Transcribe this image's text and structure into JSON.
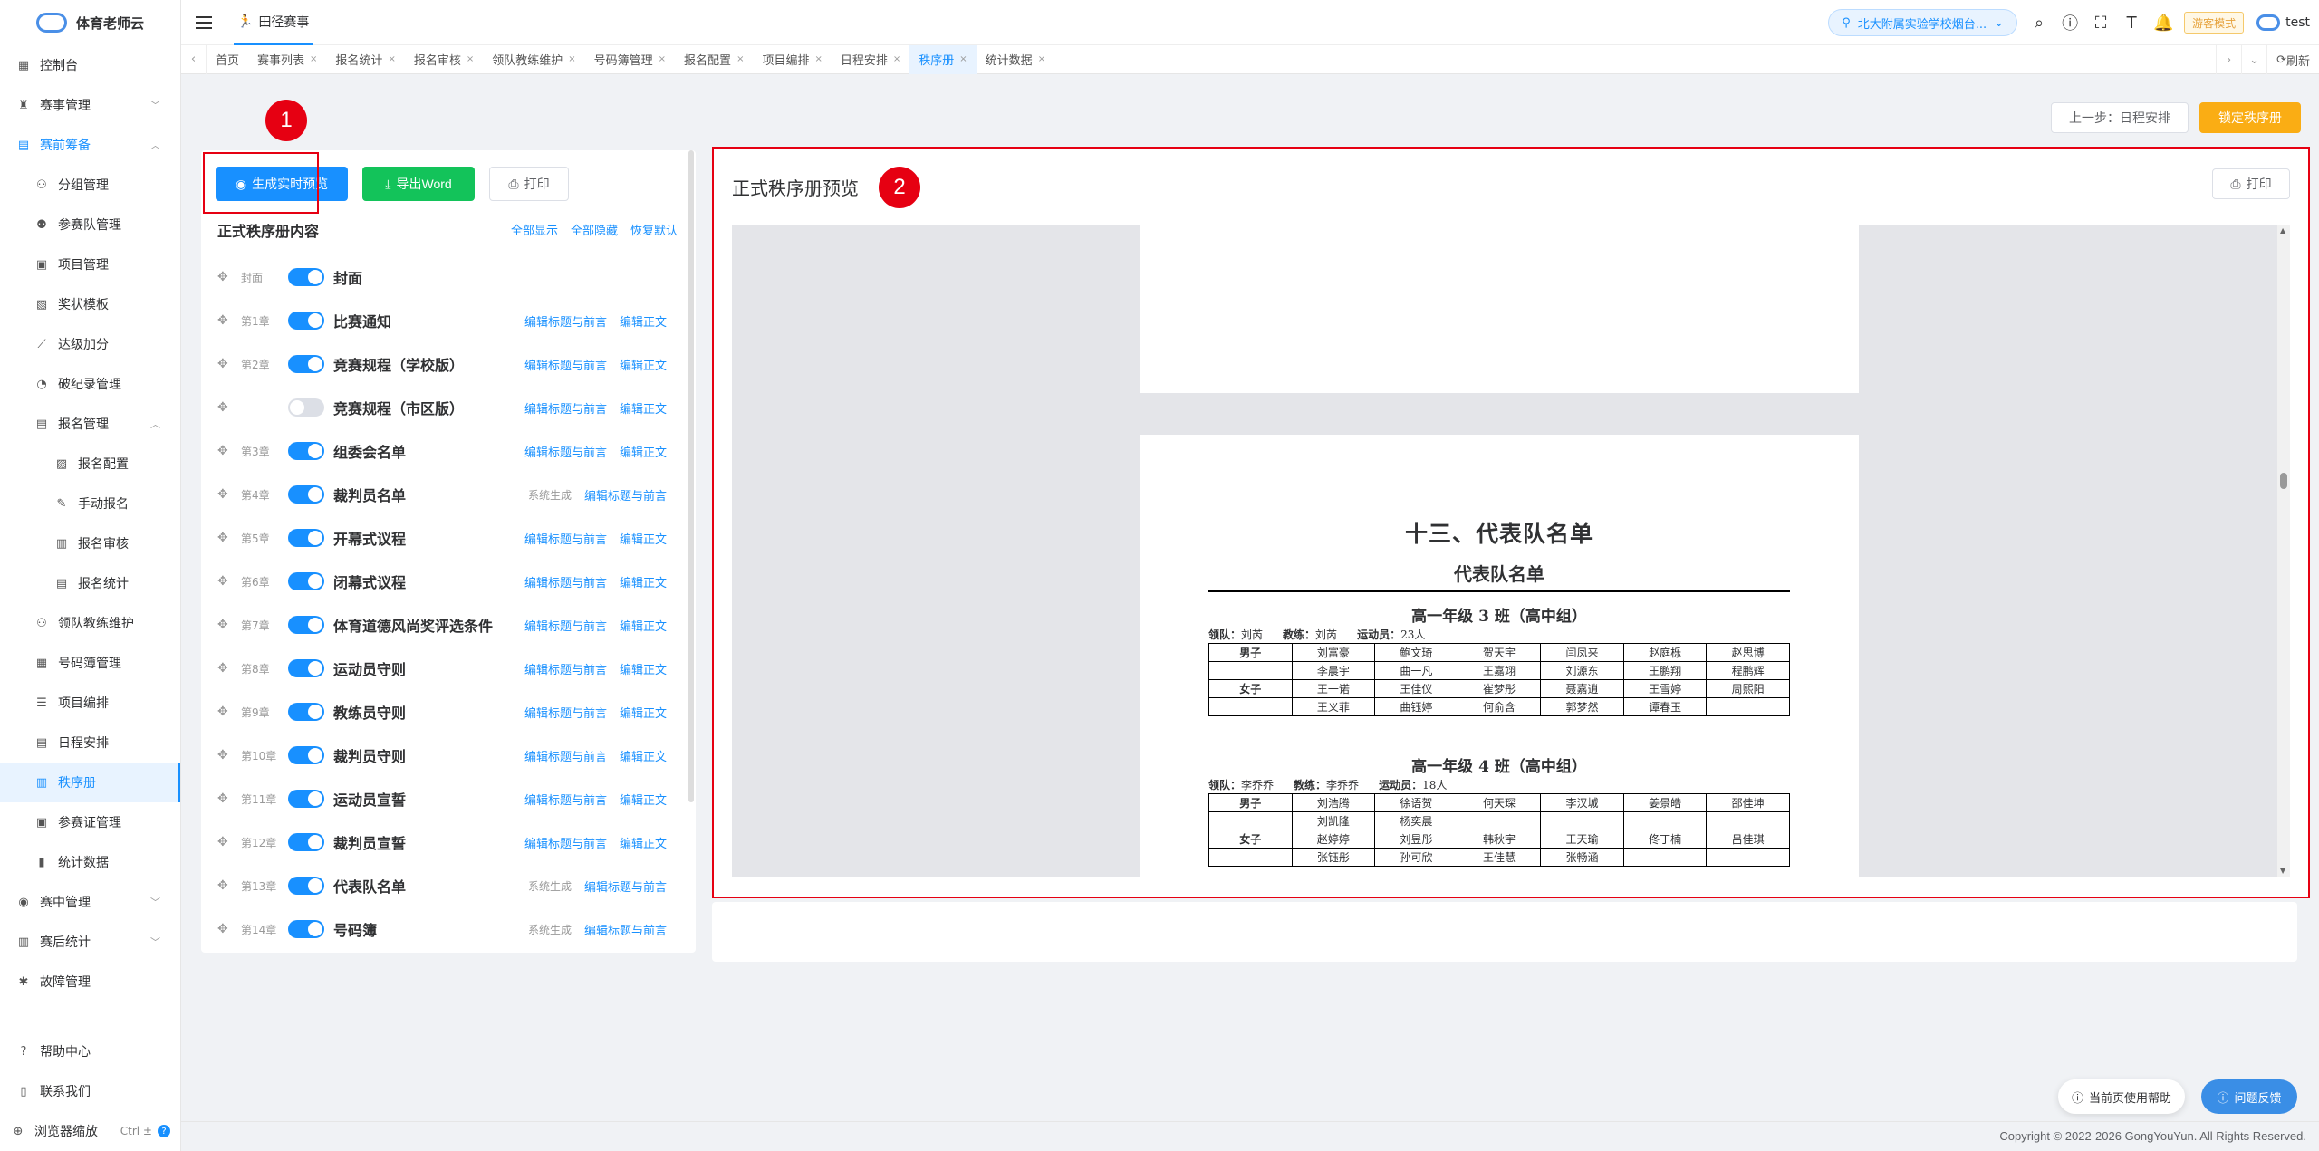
{
  "app": {
    "name": "体育老师云"
  },
  "sidebar": {
    "items": [
      {
        "label": "控制台",
        "icon": "dashboard-icon",
        "level": 0
      },
      {
        "label": "赛事管理",
        "icon": "trophy-icon",
        "level": 0,
        "arrow": "down"
      },
      {
        "label": "赛前筹备",
        "icon": "clipboard-icon",
        "level": 0,
        "arrow": "up",
        "open": true
      },
      {
        "label": "分组管理",
        "icon": "group-icon",
        "level": 1
      },
      {
        "label": "参赛队管理",
        "icon": "team-icon",
        "level": 1
      },
      {
        "label": "项目管理",
        "icon": "project-icon",
        "level": 1
      },
      {
        "label": "奖状模板",
        "icon": "certificate-icon",
        "level": 1
      },
      {
        "label": "达级加分",
        "icon": "chart-up-icon",
        "level": 1
      },
      {
        "label": "破纪录管理",
        "icon": "record-icon",
        "level": 1
      },
      {
        "label": "报名管理",
        "icon": "registration-icon",
        "level": 1,
        "arrow": "up"
      },
      {
        "label": "报名配置",
        "icon": "config-icon",
        "level": 2
      },
      {
        "label": "手动报名",
        "icon": "manual-icon",
        "level": 2
      },
      {
        "label": "报名审核",
        "icon": "audit-icon",
        "level": 2
      },
      {
        "label": "报名统计",
        "icon": "stats-icon",
        "level": 2
      },
      {
        "label": "领队教练维护",
        "icon": "coach-icon",
        "level": 1
      },
      {
        "label": "号码簿管理",
        "icon": "bib-icon",
        "level": 1
      },
      {
        "label": "项目编排",
        "icon": "arrange-icon",
        "level": 1
      },
      {
        "label": "日程安排",
        "icon": "calendar-icon",
        "level": 1
      },
      {
        "label": "秩序册",
        "icon": "book-icon",
        "level": 1,
        "active": true
      },
      {
        "label": "参赛证管理",
        "icon": "badge-icon",
        "level": 1
      },
      {
        "label": "统计数据",
        "icon": "bar-chart-icon",
        "level": 1
      },
      {
        "label": "赛中管理",
        "icon": "live-icon",
        "level": 0,
        "arrow": "down"
      },
      {
        "label": "赛后统计",
        "icon": "podium-icon",
        "level": 0,
        "arrow": "down"
      },
      {
        "label": "故障管理",
        "icon": "bug-icon",
        "level": 0
      }
    ],
    "bottom": {
      "help": "帮助中心",
      "contact": "联系我们",
      "zoom": "浏览器缩放",
      "zoom_shortcut": "Ctrl ±"
    }
  },
  "header": {
    "tab_label": "田径赛事",
    "school": "北大附属实验学校烟台...",
    "guest_mode": "游客模式",
    "user": "test"
  },
  "tags": [
    {
      "label": "首页",
      "closable": false
    },
    {
      "label": "赛事列表",
      "closable": true
    },
    {
      "label": "报名统计",
      "closable": true
    },
    {
      "label": "报名审核",
      "closable": true
    },
    {
      "label": "领队教练维护",
      "closable": true
    },
    {
      "label": "号码簿管理",
      "closable": true
    },
    {
      "label": "报名配置",
      "closable": true
    },
    {
      "label": "项目编排",
      "closable": true
    },
    {
      "label": "日程安排",
      "closable": true
    },
    {
      "label": "秩序册",
      "closable": true,
      "active": true
    },
    {
      "label": "统计数据",
      "closable": true
    }
  ],
  "tags_refresh": "刷新",
  "toolbar": {
    "prev_step": "上一步：日程安排",
    "lock": "锁定秩序册"
  },
  "left": {
    "preview_btn": "生成实时预览",
    "export_btn": "导出Word",
    "print_btn": "打印",
    "title": "正式秩序册内容",
    "show_all": "全部显示",
    "hide_all": "全部隐藏",
    "restore": "恢复默认",
    "chapters": [
      {
        "no": "封面",
        "title": "封面",
        "on": true,
        "actions": []
      },
      {
        "no": "第1章",
        "title": "比赛通知",
        "on": true,
        "actions": [
          "编辑标题与前言",
          "编辑正文"
        ]
      },
      {
        "no": "第2章",
        "title": "竞赛规程（学校版）",
        "on": true,
        "actions": [
          "编辑标题与前言",
          "编辑正文"
        ]
      },
      {
        "no": "—",
        "title": "竞赛规程（市区版）",
        "on": false,
        "actions": [
          "编辑标题与前言",
          "编辑正文"
        ]
      },
      {
        "no": "第3章",
        "title": "组委会名单",
        "on": true,
        "actions": [
          "编辑标题与前言",
          "编辑正文"
        ]
      },
      {
        "no": "第4章",
        "title": "裁判员名单",
        "on": true,
        "system": "系统生成",
        "actions": [
          "编辑标题与前言"
        ]
      },
      {
        "no": "第5章",
        "title": "开幕式议程",
        "on": true,
        "actions": [
          "编辑标题与前言",
          "编辑正文"
        ]
      },
      {
        "no": "第6章",
        "title": "闭幕式议程",
        "on": true,
        "actions": [
          "编辑标题与前言",
          "编辑正文"
        ]
      },
      {
        "no": "第7章",
        "title": "体育道德风尚奖评选条件",
        "on": true,
        "actions": [
          "编辑标题与前言",
          "编辑正文"
        ]
      },
      {
        "no": "第8章",
        "title": "运动员守则",
        "on": true,
        "actions": [
          "编辑标题与前言",
          "编辑正文"
        ]
      },
      {
        "no": "第9章",
        "title": "教练员守则",
        "on": true,
        "actions": [
          "编辑标题与前言",
          "编辑正文"
        ]
      },
      {
        "no": "第10章",
        "title": "裁判员守则",
        "on": true,
        "actions": [
          "编辑标题与前言",
          "编辑正文"
        ]
      },
      {
        "no": "第11章",
        "title": "运动员宣誓",
        "on": true,
        "actions": [
          "编辑标题与前言",
          "编辑正文"
        ]
      },
      {
        "no": "第12章",
        "title": "裁判员宣誓",
        "on": true,
        "actions": [
          "编辑标题与前言",
          "编辑正文"
        ]
      },
      {
        "no": "第13章",
        "title": "代表队名单",
        "on": true,
        "system": "系统生成",
        "actions": [
          "编辑标题与前言"
        ]
      },
      {
        "no": "第14章",
        "title": "号码簿",
        "on": true,
        "system": "系统生成",
        "actions": [
          "编辑标题与前言"
        ]
      }
    ]
  },
  "right": {
    "title": "正式秩序册预览",
    "print_btn": "打印",
    "doc": {
      "chapter_title": "十三、代表队名单",
      "subtitle": "代表队名单",
      "teams": [
        {
          "title": "高一年级 3 班（高中组）",
          "leader_label": "领队：",
          "leader": "刘芮",
          "coach_label": "教练：",
          "coach": "刘芮",
          "athletes_label": "运动员：",
          "athletes": "23人",
          "rows": [
            [
              "男子",
              "刘富豪",
              "鲍文琦",
              "贺天宇",
              "闫凤来",
              "赵庭栎",
              "赵思博"
            ],
            [
              "",
              "李晨宇",
              "曲一凡",
              "王嘉翊",
              "刘源东",
              "王鹏翔",
              "程鹏辉"
            ],
            [
              "女子",
              "王一诺",
              "王佳仪",
              "崔梦彤",
              "聂嘉逍",
              "王雪婷",
              "周熙阳"
            ],
            [
              "",
              "王义菲",
              "曲钰婷",
              "何俞含",
              "郭梦然",
              "谭春玉",
              ""
            ]
          ]
        },
        {
          "title": "高一年级 4 班（高中组）",
          "leader_label": "领队：",
          "leader": "李乔乔",
          "coach_label": "教练：",
          "coach": "李乔乔",
          "athletes_label": "运动员：",
          "athletes": "18人",
          "rows": [
            [
              "男子",
              "刘浩腾",
              "徐语贺",
              "何天琛",
              "李汉城",
              "姜景皓",
              "邵佳坤"
            ],
            [
              "",
              "刘凯隆",
              "杨奕晨",
              "",
              "",
              "",
              ""
            ],
            [
              "女子",
              "赵婷婷",
              "刘昱彤",
              "韩秋宇",
              "王天瑜",
              "佟丁楠",
              "吕佳琪"
            ],
            [
              "",
              "张钰彤",
              "孙可欣",
              "王佳慧",
              "张畅涵",
              "",
              ""
            ]
          ]
        }
      ]
    }
  },
  "annotations": {
    "one": "1",
    "two": "2"
  },
  "footer": {
    "copyright": "Copyright © 2022-2026 GongYouYun. All Rights Reserved.",
    "help_btn": "当前页使用帮助",
    "feedback_btn": "问题反馈"
  }
}
